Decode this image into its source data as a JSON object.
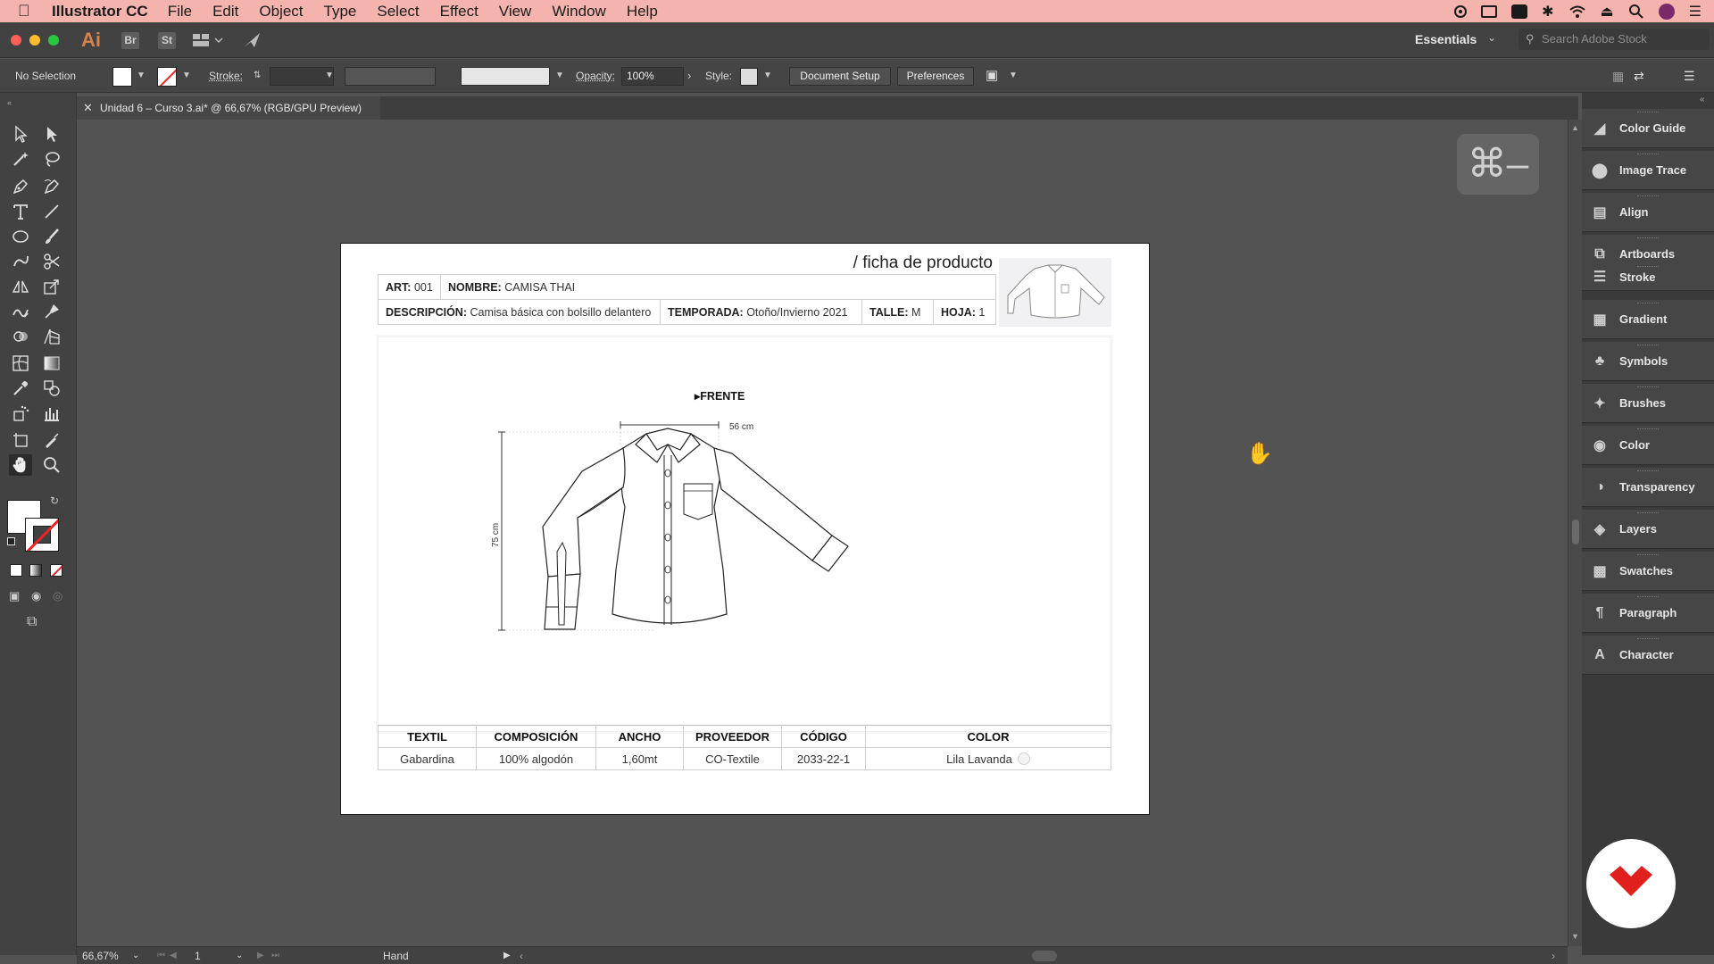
{
  "menubar": {
    "app_name": "Illustrator CC",
    "menus": [
      "File",
      "Edit",
      "Object",
      "Type",
      "Select",
      "Effect",
      "View",
      "Window",
      "Help"
    ]
  },
  "appbar": {
    "logo": "Ai",
    "bridge": "Br",
    "stock": "St",
    "workspace": "Essentials",
    "search_placeholder": "Search Adobe Stock"
  },
  "controlbar": {
    "selection": "No Selection",
    "stroke_label": "Stroke:",
    "opacity_label": "Opacity:",
    "opacity_value": "100%",
    "style_label": "Style:",
    "document_setup": "Document Setup",
    "preferences": "Preferences"
  },
  "tab": {
    "title": "Unidad 6 – Curso 3.ai* @ 66,67% (RGB/GPU Preview)"
  },
  "overlay": {
    "shortcut": "⌘–"
  },
  "artboard": {
    "title": "/ ficha de producto",
    "header": {
      "art_label": "ART:",
      "art_value": "001",
      "nombre_label": "NOMBRE:",
      "nombre_value": "CAMISA THAI",
      "descripcion_label": "DESCRIPCIÓN:",
      "descripcion_value": "Camisa básica con bolsillo delantero",
      "temporada_label": "TEMPORADA:",
      "temporada_value": "Otoño/Invierno 2021",
      "talle_label": "TALLE:",
      "talle_value": "M",
      "hoja_label": "HOJA:",
      "hoja_value": "1"
    },
    "view_label": "FRENTE",
    "width_dim": "56 cm",
    "height_dim": "75 cm",
    "materials": {
      "columns": [
        "TEXTIL",
        "COMPOSICIÓN",
        "ANCHO",
        "PROVEEDOR",
        "CÓDIGO",
        "COLOR"
      ],
      "row": [
        "Gabardina",
        "100% algodón",
        "1,60mt",
        "CO-Textile",
        "2033-22-1",
        "Lila Lavanda"
      ]
    }
  },
  "panels": [
    {
      "label": "Color Guide",
      "icon": "color-guide-icon"
    },
    {
      "label": "Image Trace",
      "icon": "image-trace-icon"
    },
    {
      "label": "Align",
      "icon": "align-icon"
    },
    {
      "label": "Artboards",
      "icon": "artboards-icon"
    },
    {
      "label": "Stroke",
      "icon": "stroke-icon"
    },
    {
      "label": "Gradient",
      "icon": "gradient-icon"
    },
    {
      "label": "Symbols",
      "icon": "symbols-icon"
    },
    {
      "label": "Brushes",
      "icon": "brushes-icon"
    },
    {
      "label": "Color",
      "icon": "color-icon"
    },
    {
      "label": "Transparency",
      "icon": "transparency-icon"
    },
    {
      "label": "Layers",
      "icon": "layers-icon"
    },
    {
      "label": "Swatches",
      "icon": "swatches-icon"
    },
    {
      "label": "Paragraph",
      "icon": "paragraph-icon"
    },
    {
      "label": "Character",
      "icon": "character-icon"
    }
  ],
  "statusbar": {
    "zoom": "66,67%",
    "artboard_number": "1",
    "tool": "Hand"
  },
  "colors": {
    "menubar_bg": "#f4b4ad",
    "app_logo": "#d8824a",
    "brand_red": "#e0201c"
  }
}
